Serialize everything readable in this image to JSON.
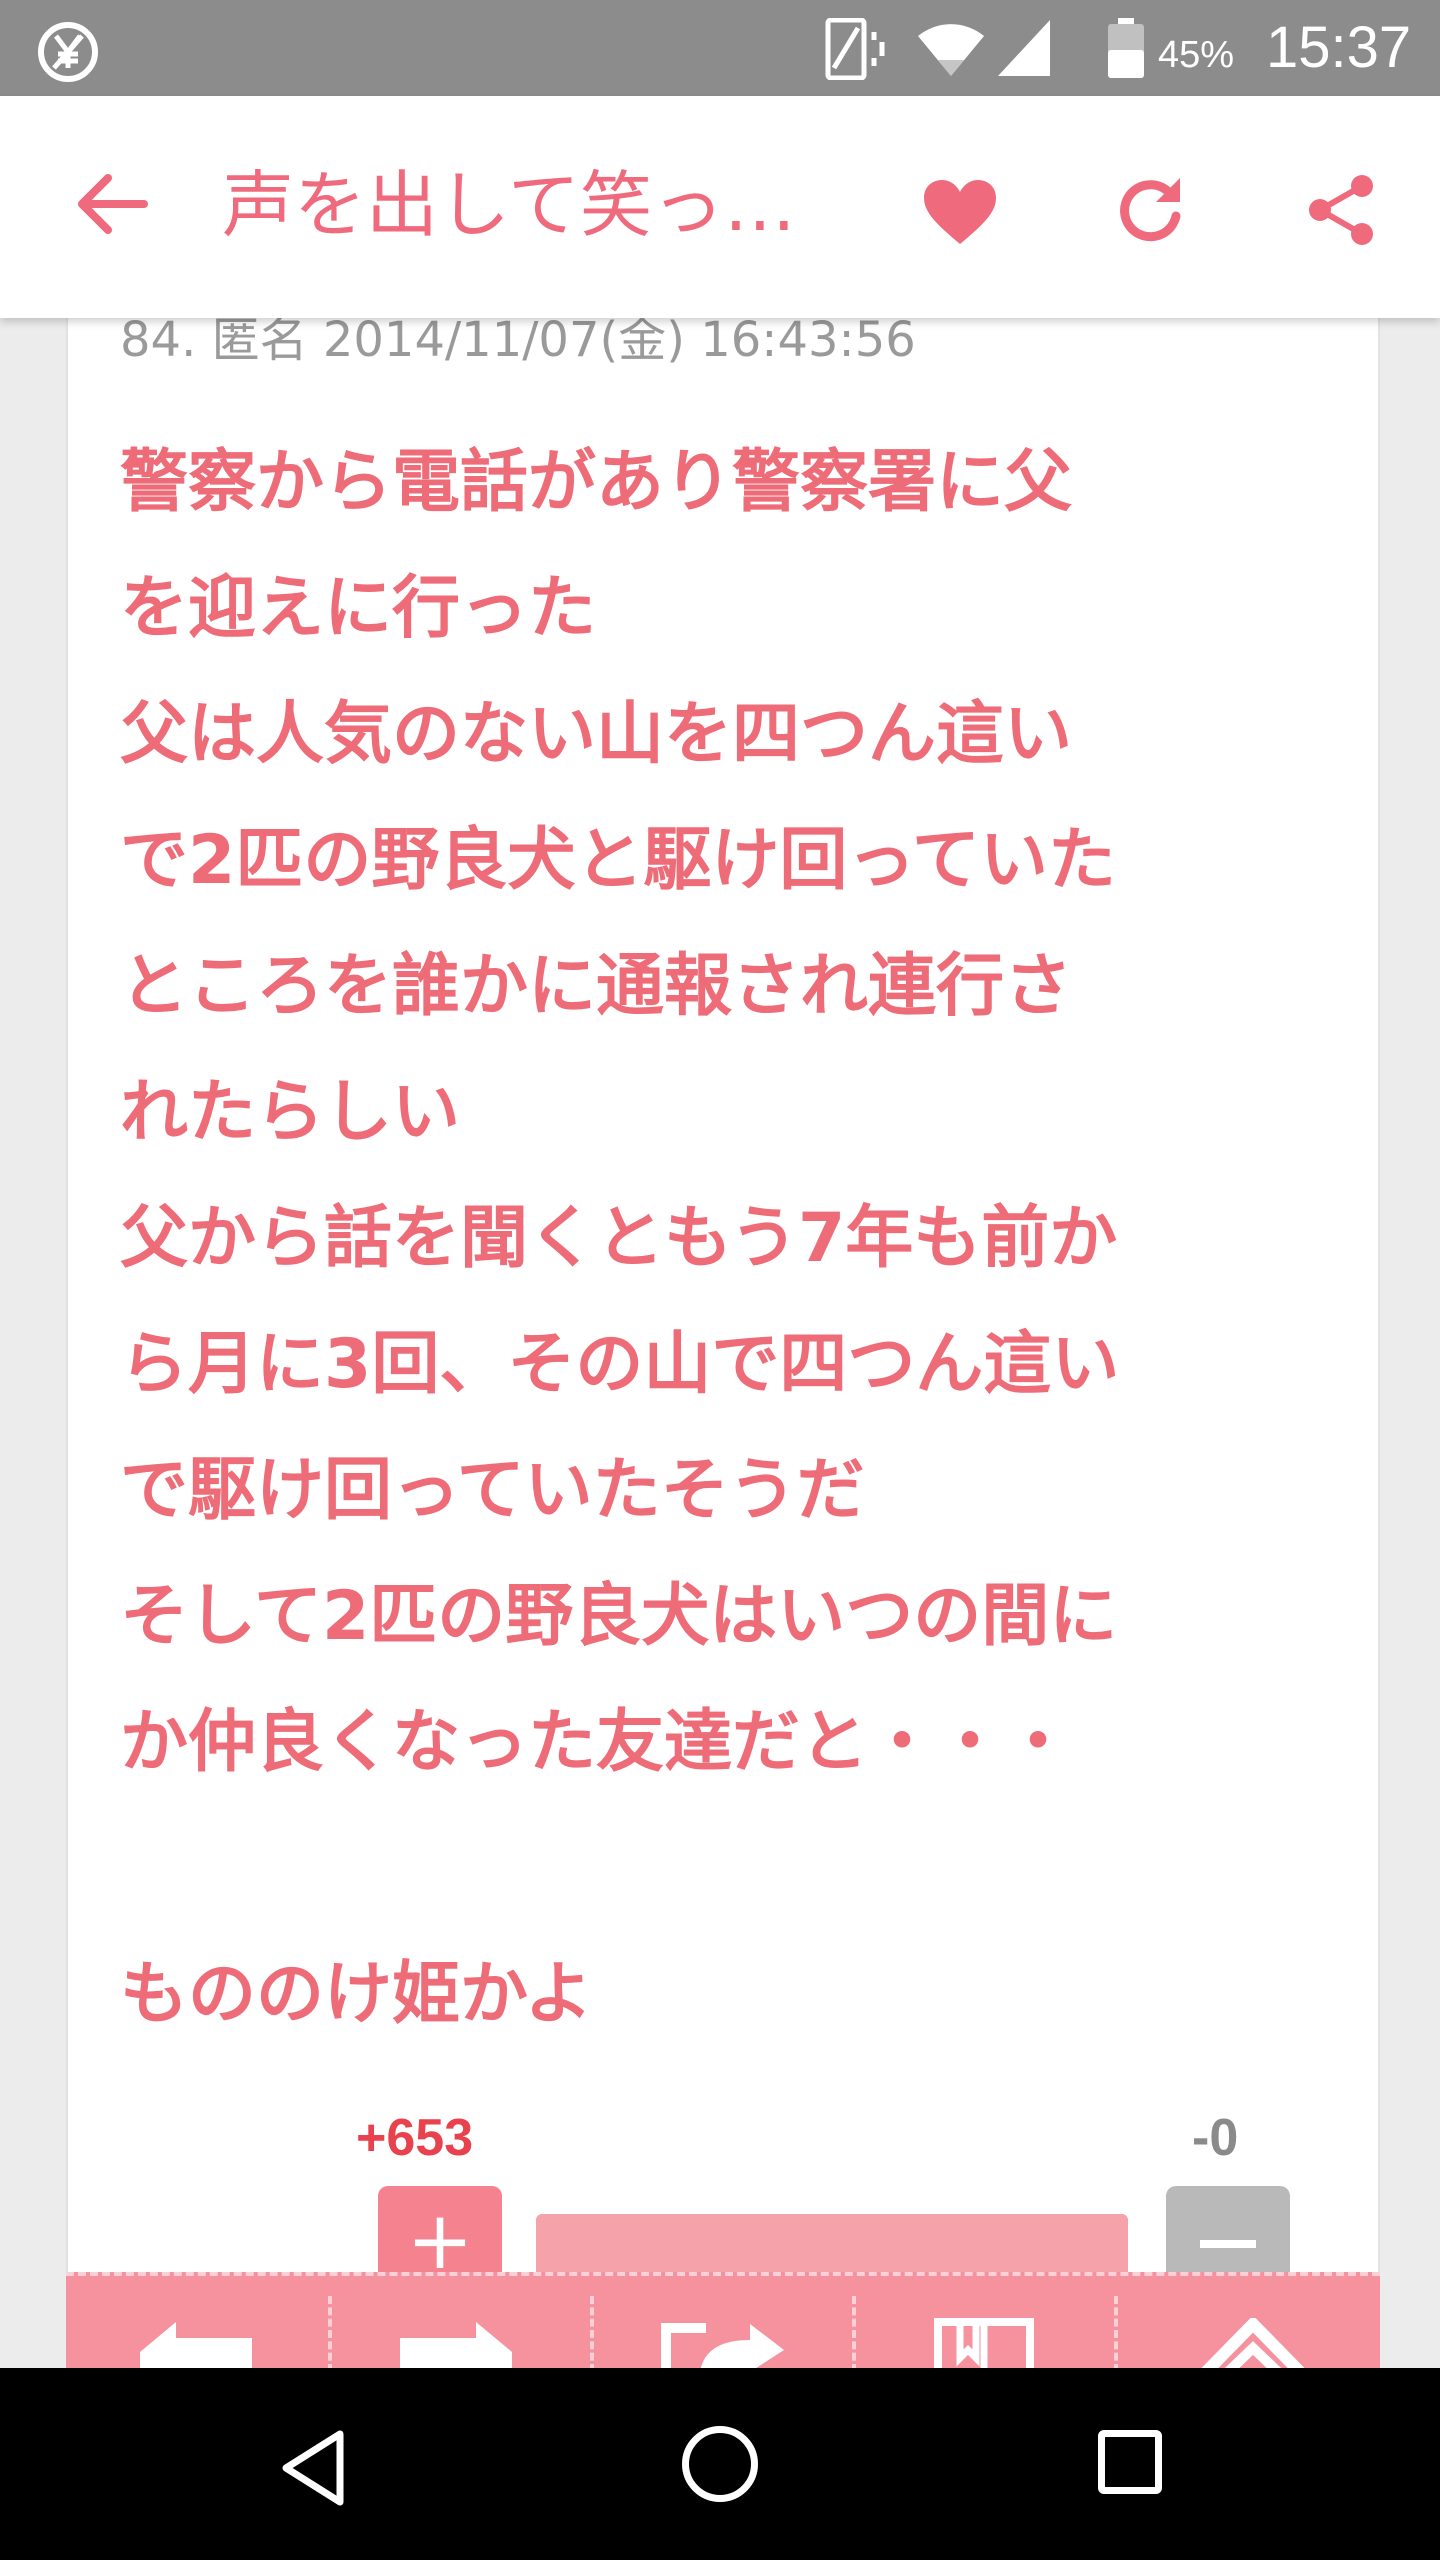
{
  "status_bar": {
    "battery_percent": "45%",
    "time": "15:37",
    "icons": [
      "no-fee-icon",
      "vibrate-icon",
      "wifi-icon",
      "signal-icon",
      "battery-icon"
    ]
  },
  "app_bar": {
    "title": "声を出して笑っ…",
    "icons": [
      "back-arrow-icon",
      "heart-icon",
      "refresh-icon",
      "share-icon"
    ],
    "accent_color": "#f06a7d"
  },
  "post": {
    "meta": "84. 匿名 2014/11/07(金) 16:43:56",
    "lines": [
      "警察から電話があり警察署に父",
      "を迎えに行った",
      "父は人気のない山を四つん這い",
      "で2匹の野良犬と駆け回っていた",
      "ところを誰かに通報され連行さ",
      "れたらしい",
      "父から話を聞くともう7年も前か",
      "ら月に3回、その山で四つん這い",
      "で駆け回っていたそうだ",
      "そして2匹の野良犬はいつの間に",
      "か仲良くなった友達だと・・・",
      "",
      "もののけ姫かよ"
    ],
    "text_color": "#ee6b78"
  },
  "votes": {
    "plus_count": "+653",
    "minus_count": "-0",
    "plus_label": "+"
  },
  "bottom_toolbar": {
    "icons": [
      "left-arrow-icon",
      "right-arrow-icon",
      "forward-share-icon",
      "bookmark-book-icon",
      "scroll-top-icon"
    ]
  },
  "nav_bar": {
    "icons": [
      "nav-back-icon",
      "nav-home-icon",
      "nav-recent-icon"
    ]
  }
}
